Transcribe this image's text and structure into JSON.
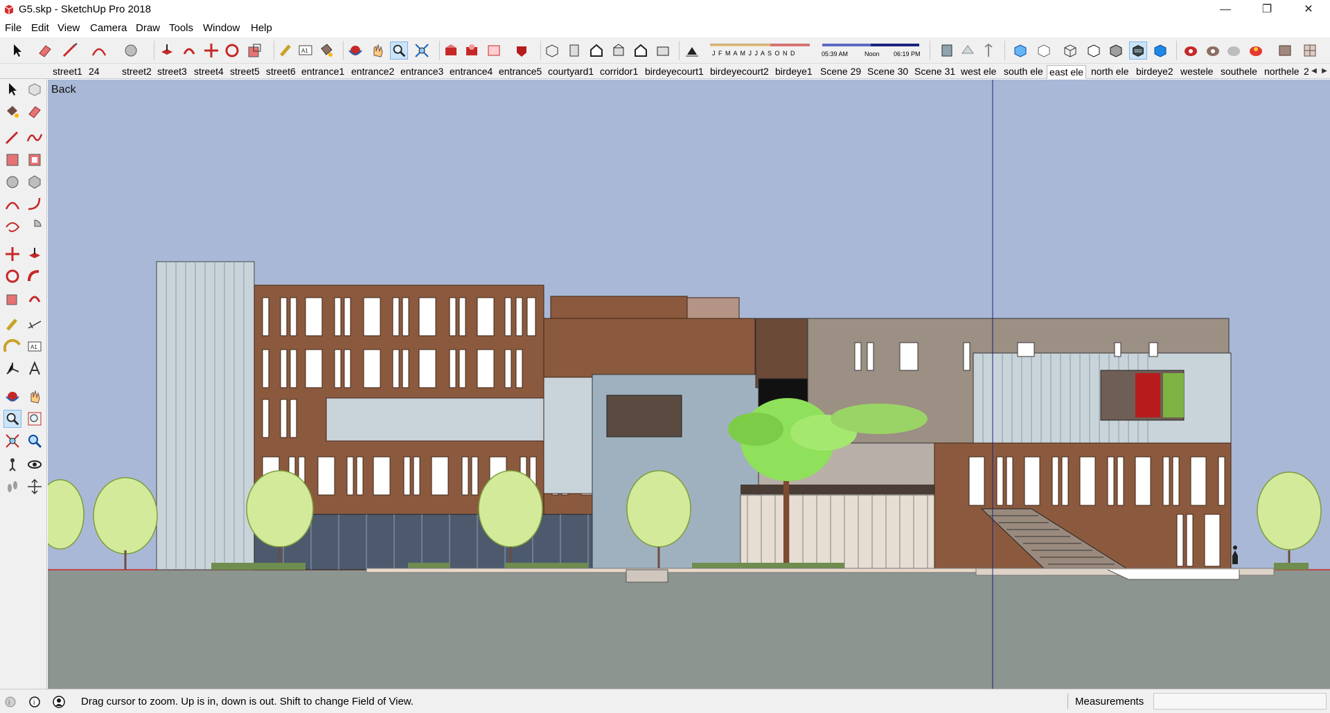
{
  "window": {
    "title": "G5.skp - SketchUp Pro 2018"
  },
  "menubar": {
    "items": [
      "File",
      "Edit",
      "View",
      "Camera",
      "Draw",
      "Tools",
      "Window",
      "Help"
    ]
  },
  "toolbar": {
    "shadow_months": "J F M A M J J A S O N D",
    "shadow_time_start": "05:39 AM",
    "shadow_time_mid": "Noon",
    "shadow_time_end": "06:19 PM"
  },
  "scenes": {
    "tabs": [
      "street1",
      "24",
      "street2",
      "street3",
      "street4",
      "street5",
      "street6",
      "entrance1",
      "entrance2",
      "entrance3",
      "entrance4",
      "entrance5",
      "courtyard1",
      "corridor1",
      "birdeyecourt1",
      "birdeyecourt2",
      "birdeye1",
      "Scene 29",
      "Scene 30",
      "Scene 31",
      "west ele",
      "south ele",
      "east ele",
      "north ele",
      "birdeye2",
      "westele",
      "southele",
      "northele",
      "2"
    ],
    "active": "east ele"
  },
  "viewport": {
    "view_label": "Back"
  },
  "statusbar": {
    "hint": "Drag cursor to zoom.  Up is in, down is out. Shift to change Field of View.",
    "measurements_label": "Measurements",
    "measurements_value": ""
  },
  "colors": {
    "sky": "#a9b8d6",
    "ground": "#8c958f",
    "brick": "#8b5a3e",
    "glass": "#c9d4da",
    "tree": "#d2ea9a"
  }
}
